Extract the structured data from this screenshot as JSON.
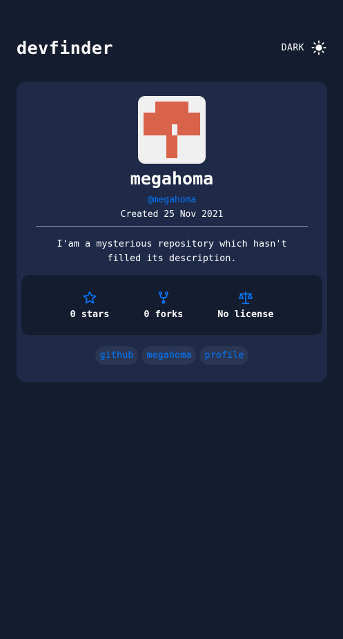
{
  "header": {
    "title": "devfinder",
    "theme_label": "DARK",
    "theme_icon": "sun-icon"
  },
  "profile": {
    "name": "megahoma",
    "handle": "@megahoma",
    "created": "Created 25 Nov 2021",
    "description": "I'am a mysterious repository which hasn't filled its description.",
    "avatar_color": "#d9634a",
    "avatar_background": "#f0f0f0"
  },
  "stats": [
    {
      "icon": "star-icon",
      "label": "0 stars"
    },
    {
      "icon": "fork-icon",
      "label": "0 forks"
    },
    {
      "icon": "scale-icon",
      "label": "No license"
    }
  ],
  "tags": [
    "github",
    "megahoma",
    "profile"
  ],
  "colors": {
    "background": "#141c2f",
    "card": "#1e2a47",
    "accent": "#0079ff",
    "text": "#ffffff"
  }
}
